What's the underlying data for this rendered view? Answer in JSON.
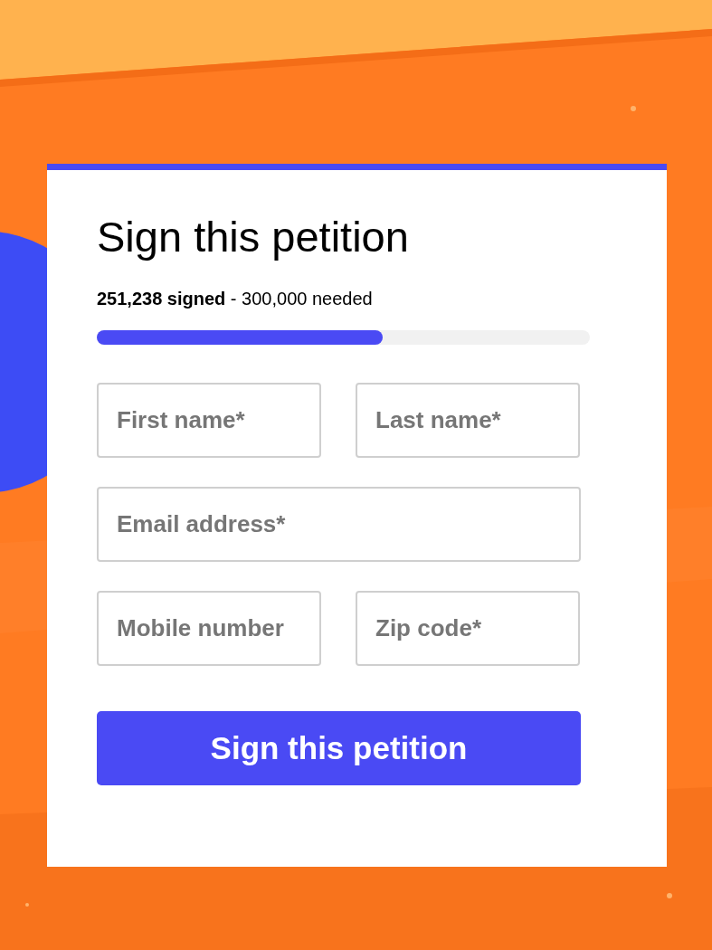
{
  "petition": {
    "title": "Sign this petition",
    "count": "**251,238 signed** - 300,000 needed",
    "progress": {
      "level": 0.58
    },
    "fields": [
      {
        "placeholder": "First name*",
        "kind": "half"
      },
      {
        "placeholder": "Last name*",
        "kind": "half"
      },
      {
        "placeholder": "Email address*",
        "kind": "full"
      },
      {
        "placeholder": "Mobile number",
        "kind": "half"
      },
      {
        "placeholder": "Zip code*",
        "kind": "half"
      }
    ],
    "button": "Sign this petition"
  }
}
